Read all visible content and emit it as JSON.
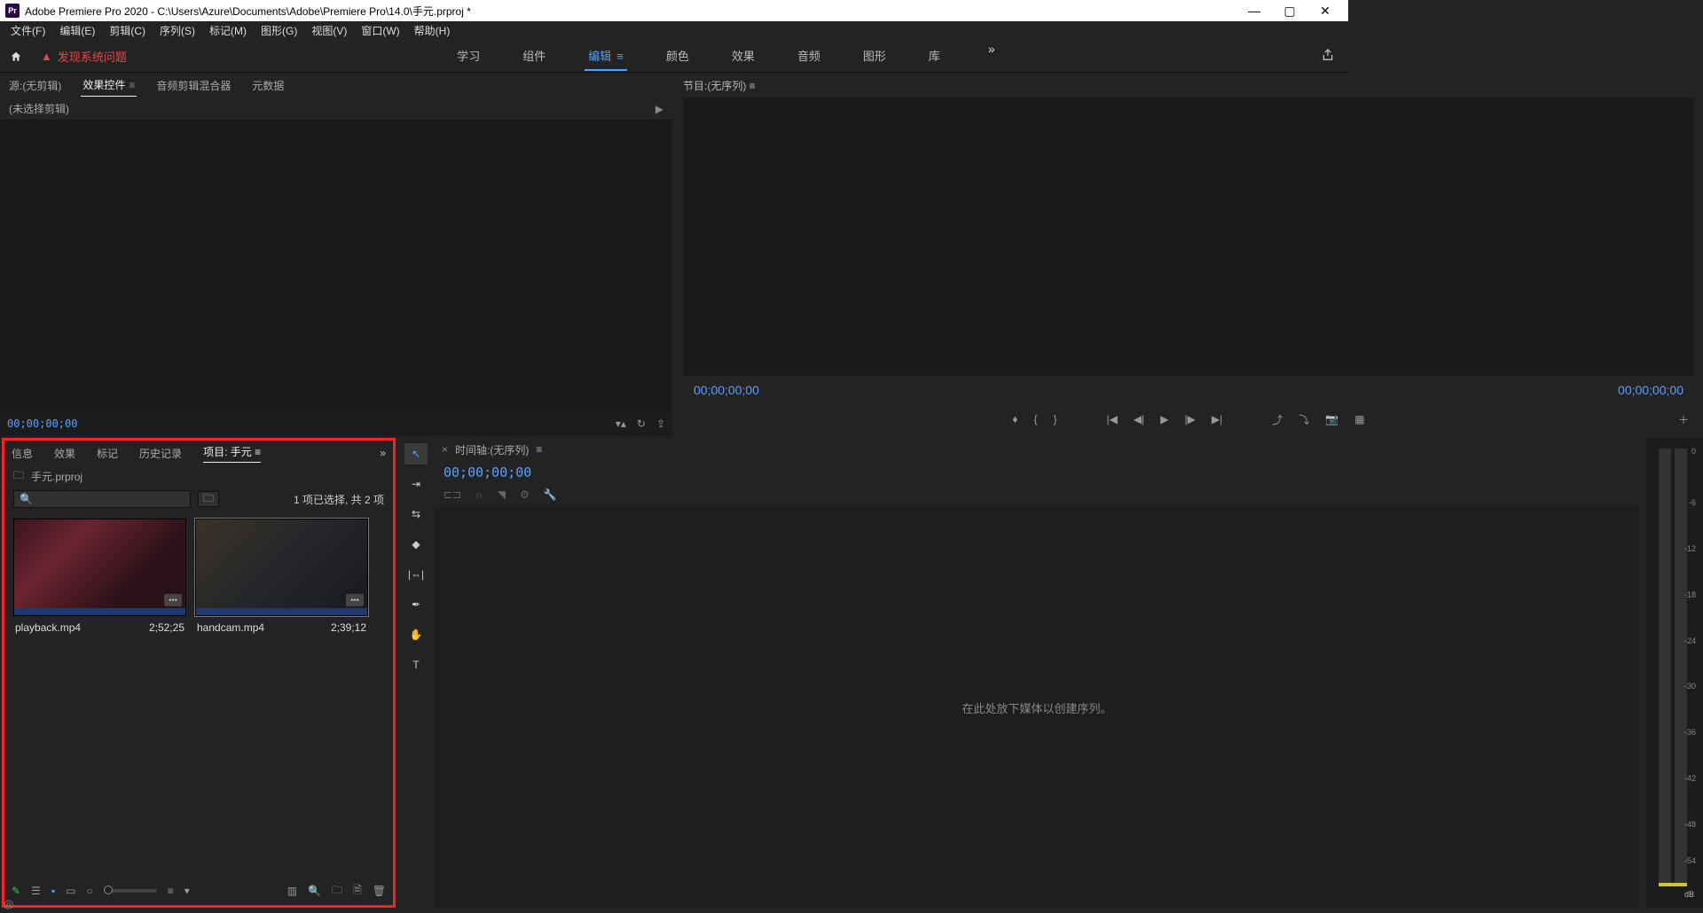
{
  "titlebar": {
    "app_abbr": "Pr",
    "title": "Adobe Premiere Pro 2020 - C:\\Users\\Azure\\Documents\\Adobe\\Premiere Pro\\14.0\\手元.prproj *"
  },
  "menubar": [
    "文件(F)",
    "编辑(E)",
    "剪辑(C)",
    "序列(S)",
    "标记(M)",
    "图形(G)",
    "视图(V)",
    "窗口(W)",
    "帮助(H)"
  ],
  "workspace": {
    "warning": "发现系统问题",
    "tabs": [
      "学习",
      "组件",
      "编辑",
      "颜色",
      "效果",
      "音频",
      "图形",
      "库"
    ],
    "active": "编辑"
  },
  "source_panel": {
    "tabs": [
      "源:(无剪辑)",
      "效果控件",
      "音频剪辑混合器",
      "元数据"
    ],
    "active": "效果控件",
    "clip_select": "(未选择剪辑)",
    "timecode": "00;00;00;00"
  },
  "program_panel": {
    "title": "节目:(无序列)",
    "timecode_left": "00;00;00;00",
    "timecode_right": "00;00;00;00"
  },
  "project_panel": {
    "tabs": [
      "信息",
      "效果",
      "标记",
      "历史记录",
      "项目: 手元"
    ],
    "active": "项目: 手元",
    "project_file": "手元.prproj",
    "selection_text": "1 项已选择, 共 2 项",
    "clips": [
      {
        "name": "playback.mp4",
        "duration": "2;52;25",
        "selected": false
      },
      {
        "name": "handcam.mp4",
        "duration": "2;39;12",
        "selected": true
      }
    ]
  },
  "timeline": {
    "title": "时间轴:(无序列)",
    "timecode": "00;00;00;00",
    "placeholder": "在此处放下媒体以创建序列。"
  },
  "audio_meter": {
    "ticks": [
      "0",
      "-6",
      "-12",
      "-18",
      "-24",
      "-30",
      "-36",
      "-42",
      "-48",
      "-54"
    ],
    "unit": "dB"
  }
}
